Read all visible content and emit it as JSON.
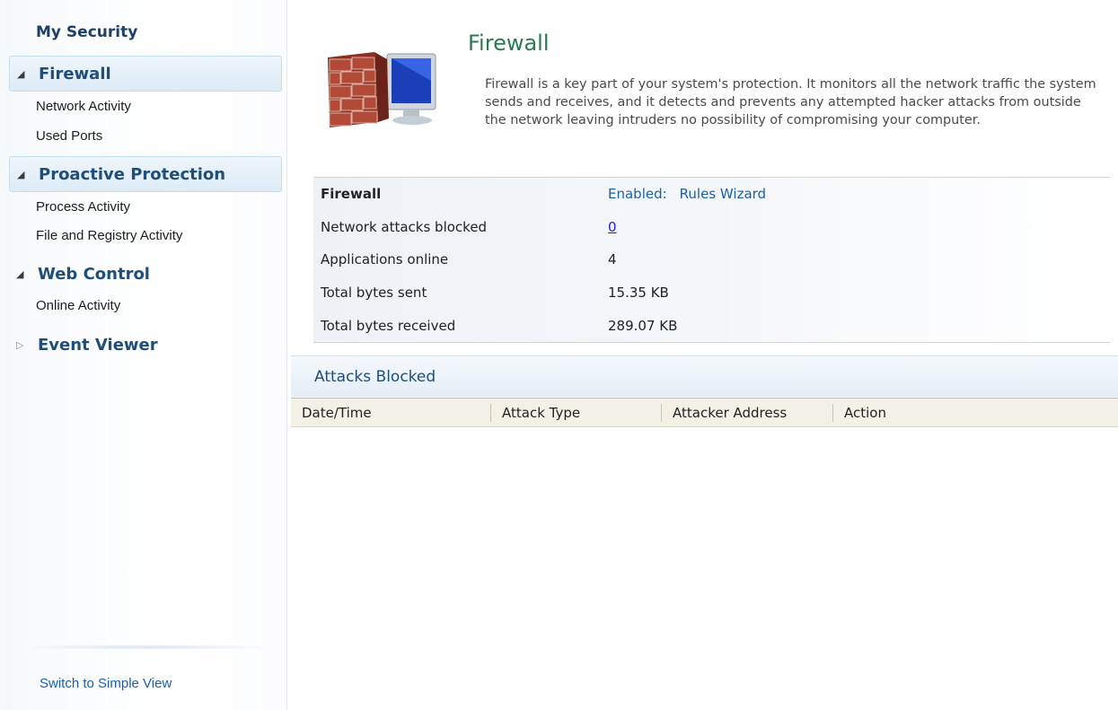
{
  "sidebar": {
    "title": "My Security",
    "sections": [
      {
        "label": "Firewall",
        "expanded": true,
        "items": [
          "Network Activity",
          "Used Ports"
        ]
      },
      {
        "label": "Proactive Protection",
        "expanded": true,
        "items": [
          "Process Activity",
          "File and Registry Activity"
        ]
      },
      {
        "label": "Web Control",
        "expanded": true,
        "items": [
          "Online Activity"
        ]
      },
      {
        "label": "Event Viewer",
        "expanded": false,
        "items": []
      }
    ],
    "switch_link": "Switch to Simple View"
  },
  "main": {
    "title": "Firewall",
    "description": "Firewall is a key part of your system's protection. It monitors all the network traffic the system sends and receives, and it detects and prevents any attempted hacker attacks from outside the network leaving intruders no possibility of compromising your computer.",
    "status_rows": [
      {
        "label": "Firewall",
        "status": "Enabled:",
        "action": "Rules Wizard"
      },
      {
        "label": "Network attacks blocked",
        "value": "0"
      },
      {
        "label": "Applications online",
        "value": "4"
      },
      {
        "label": "Total bytes sent",
        "value": "15.35 KB"
      },
      {
        "label": "Total bytes received",
        "value": "289.07 KB"
      }
    ],
    "attacks": {
      "title": "Attacks Blocked",
      "columns": [
        "Date/Time",
        "Attack Type",
        "Attacker Address",
        "Action"
      ]
    }
  },
  "colors": {
    "accent_link": "#1c5fa8",
    "title_green": "#2a7a4b",
    "section_blue": "#1f4e79"
  }
}
